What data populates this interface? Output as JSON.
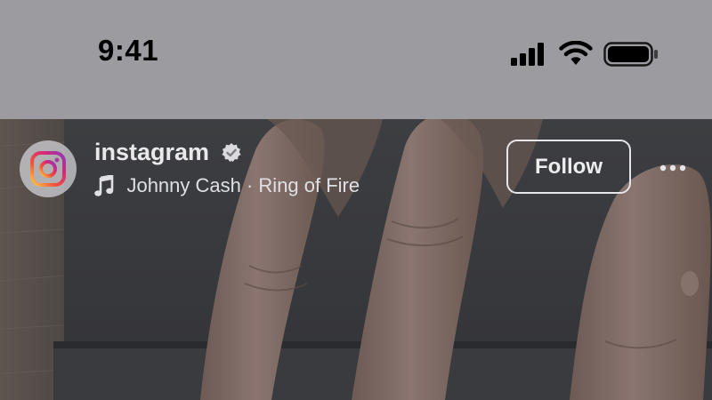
{
  "status_bar": {
    "time": "9:41",
    "icons": [
      "cellular-signal-icon",
      "wifi-icon",
      "battery-icon"
    ]
  },
  "post": {
    "avatar_icon": "instagram-logo-icon",
    "username": "instagram",
    "verified_icon": "verified-badge-icon",
    "music_icon": "music-note-icon",
    "music": "Johnny Cash · Ring of Fire",
    "follow_label": "Follow",
    "more_icon": "more-options-icon"
  },
  "colors": {
    "status_bar_bg": "#9b9ba0",
    "text_light": "#e9e9ec",
    "instagram_gradient": [
      "#fcca4a",
      "#f0523a",
      "#d6287a",
      "#8a3ab9"
    ]
  }
}
